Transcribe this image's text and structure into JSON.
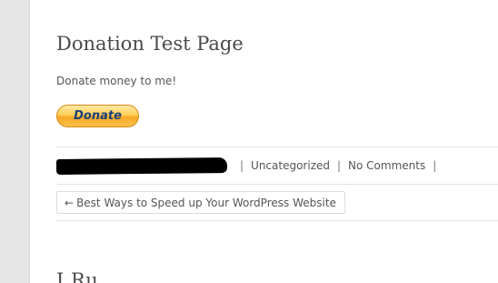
{
  "post": {
    "title": "Donation Test Page",
    "body": "Donate money to me!",
    "donate_label": "Donate"
  },
  "meta": {
    "separator": "|",
    "category": "Uncategorized",
    "comments": "No Comments"
  },
  "navigation": {
    "prev_arrow": "←",
    "prev_title": "Best Ways to Speed up Your WordPress Website"
  },
  "next_post": {
    "title_partial": "I      Ru"
  },
  "colors": {
    "donate_gradient_top": "#ffe9a8",
    "donate_gradient_bottom": "#f7a928",
    "donate_text": "#1d3f7a",
    "text": "#555555"
  }
}
